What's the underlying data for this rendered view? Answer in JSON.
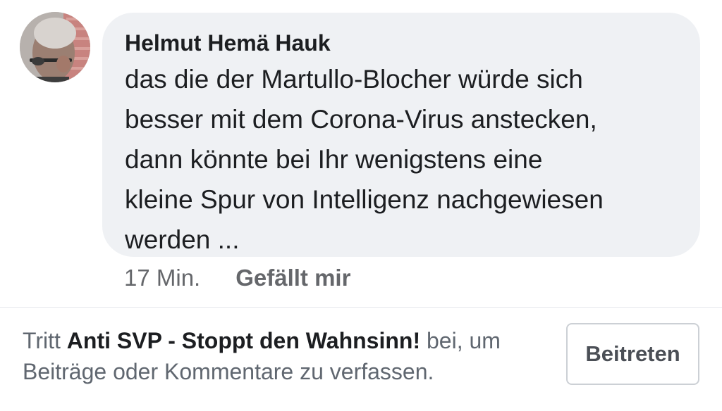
{
  "comment": {
    "author": "Helmut Hemä Hauk",
    "text_lines": [
      "das die der Martullo-Blocher würde sich",
      "besser mit dem Corona-Virus anstecken,",
      "dann könnte bei Ihr wenigstens eine",
      "kleine Spur von Intelligenz nachgewiesen",
      "werden ..."
    ],
    "timestamp": "17 Min.",
    "like_label": "Gefällt mir"
  },
  "join_prompt": {
    "prefix": "Tritt ",
    "group_name": "Anti SVP - Stoppt den Wahnsinn!",
    "suffix_line1": " bei, um",
    "line2": "Beiträge oder Kommentare zu verfassen.",
    "button_label": "Beitreten"
  },
  "icons": {
    "avatar": "user-profile-photo"
  },
  "colors": {
    "bubble_background": "#eff1f4",
    "primary_text": "#1c1e21",
    "secondary_text": "#65676b"
  }
}
